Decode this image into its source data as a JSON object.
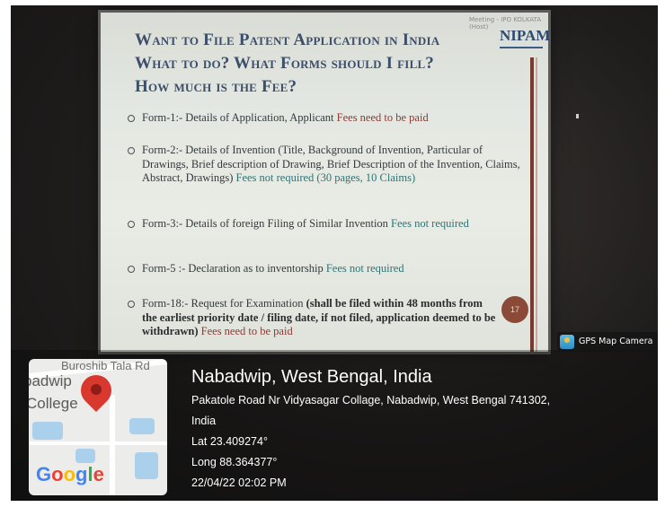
{
  "screen_caption": "Meeting - IPO KOLKATA (Host)",
  "slide": {
    "title_lines": [
      "Want to File Patent Application in India",
      "What to do?  What Forms should I fill?",
      "How much is the Fee?"
    ],
    "logo_text": "NIPAM",
    "page_number": "17",
    "bullets": [
      {
        "text": "Form-1:- Details of Application, Applicant ",
        "fee": "Fees need to be paid"
      },
      {
        "text": "Form-2:- Details of Invention (Title, Background of Invention, Particular of Drawings, Brief description of Drawing, Brief Description of the Invention, Claims, Abstract, Drawings) ",
        "fee": "Fees not required (30 pages, 10 Claims)"
      },
      {
        "text": "Form-3:- Details of foreign Filing of Similar Invention ",
        "fee": "Fees not required"
      },
      {
        "text": "Form-5 :- Declaration as to inventorship ",
        "fee": "Fees not required"
      },
      {
        "text": "Form-18:- Request for Examination ",
        "bold": "(shall be filed within 48 months from the earliest priority date / filing date, if not filed, application deemed to be withdrawn)",
        "fee": " Fees need to be paid"
      }
    ]
  },
  "gps_app": {
    "label": "GPS Map Camera"
  },
  "map": {
    "road_label": "Buroshib Tala Rd",
    "place_line1": "badwip",
    "place_line2": "College",
    "google_letters": [
      "G",
      "o",
      "o",
      "g",
      "l",
      "e"
    ],
    "google_colors": [
      "#4285f4",
      "#ea4335",
      "#fbbc05",
      "#4285f4",
      "#34a853",
      "#ea4335"
    ]
  },
  "location": {
    "title": "Nabadwip, West Bengal, India",
    "address_line1": "Pakatole Road Nr Vidyasagar Collage, Nabadwip, West Bengal 741302,",
    "address_line2": "India",
    "lat": "Lat 23.409274°",
    "long": "Long 88.364377°",
    "datetime": "22/04/22 02:02 PM"
  }
}
